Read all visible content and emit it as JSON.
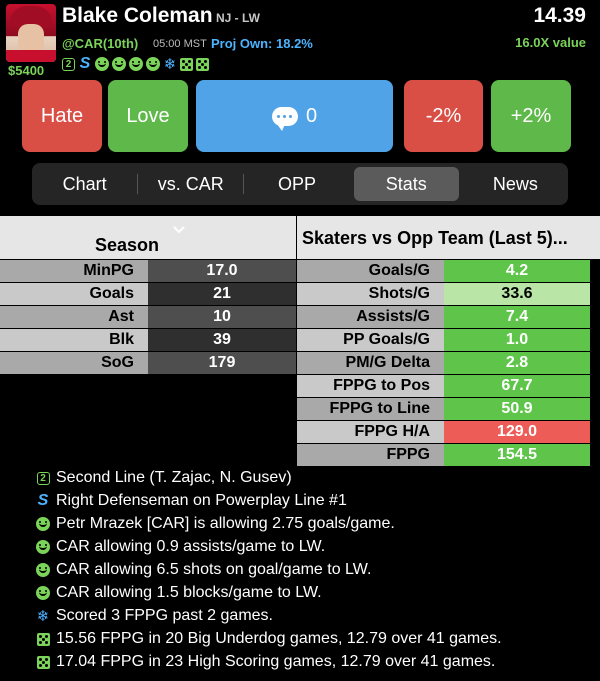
{
  "player": {
    "name": "Blake Coleman",
    "team_pos": "NJ - LW",
    "salary": "$5400",
    "score": "14.39",
    "value": "16.0X value",
    "matchup": "@CAR(10th)",
    "game_time": "05:00 MST",
    "proj_own": "Proj Own: 18.2%"
  },
  "badges": [
    "line-2-badge",
    "powerplay-s-badge",
    "smile-icon",
    "smile-icon",
    "smile-icon",
    "smile-icon",
    "snowflake-icon",
    "dice-icon",
    "dice-icon"
  ],
  "buttons": {
    "hate": "Hate",
    "love": "Love",
    "comments": "0",
    "minus": "-2%",
    "plus": "+2%"
  },
  "tabs": [
    "Chart",
    "vs. CAR",
    "OPP",
    "Stats",
    "News"
  ],
  "selected_tab": "Stats",
  "season": {
    "title": "Season",
    "rows": [
      {
        "label": "MinPG",
        "value": "17.0"
      },
      {
        "label": "Goals",
        "value": "21"
      },
      {
        "label": "Ast",
        "value": "10"
      },
      {
        "label": "Blk",
        "value": "39"
      },
      {
        "label": "SoG",
        "value": "179"
      }
    ]
  },
  "opp": {
    "title": "Skaters vs Opp Team (Last 5)...",
    "rows": [
      {
        "label": "Goals/G",
        "value": "4.2",
        "color": "#5ec54a"
      },
      {
        "label": "Shots/G",
        "value": "33.6",
        "color": "#b9e6a6"
      },
      {
        "label": "Assists/G",
        "value": "7.4",
        "color": "#5ec54a"
      },
      {
        "label": "PP Goals/G",
        "value": "1.0",
        "color": "#5ec54a"
      },
      {
        "label": "PM/G Delta",
        "value": "2.8",
        "color": "#5ec54a"
      },
      {
        "label": "FPPG to Pos",
        "value": "67.7",
        "color": "#5ec54a"
      },
      {
        "label": "FPPG to Line",
        "value": "50.9",
        "color": "#5ec54a"
      },
      {
        "label": "FPPG H/A",
        "value": "129.0",
        "color": "#ee5c57"
      },
      {
        "label": "FPPG",
        "value": "154.5",
        "color": "#5ec54a"
      }
    ]
  },
  "notes": [
    {
      "icon": "line-2-badge",
      "text": "Second Line (T. Zajac, N. Gusev)"
    },
    {
      "icon": "powerplay-s-badge",
      "text": "Right Defenseman on Powerplay Line #1"
    },
    {
      "icon": "smile-icon",
      "text": "Petr Mrazek [CAR] is allowing 2.75 goals/game."
    },
    {
      "icon": "smile-icon",
      "text": "CAR allowing 0.9 assists/game to LW."
    },
    {
      "icon": "smile-icon",
      "text": "CAR allowing 6.5 shots on goal/game to LW."
    },
    {
      "icon": "smile-icon",
      "text": "CAR allowing 1.5 blocks/game to LW."
    },
    {
      "icon": "snowflake-icon",
      "text": "Scored 3 FPPG past 2 games."
    },
    {
      "icon": "dice-icon",
      "text": "15.56 FPPG in 20 Big Underdog games, 12.79 over 41 games."
    },
    {
      "icon": "dice-icon",
      "text": "17.04 FPPG in 23 High Scoring games, 12.79 over 41 games."
    }
  ],
  "colors": {
    "accent_green": "#7bd35a",
    "accent_blue": "#4cb3ff",
    "hate": "#d94f46",
    "love": "#5fb84a",
    "comment": "#4fa3e6"
  }
}
